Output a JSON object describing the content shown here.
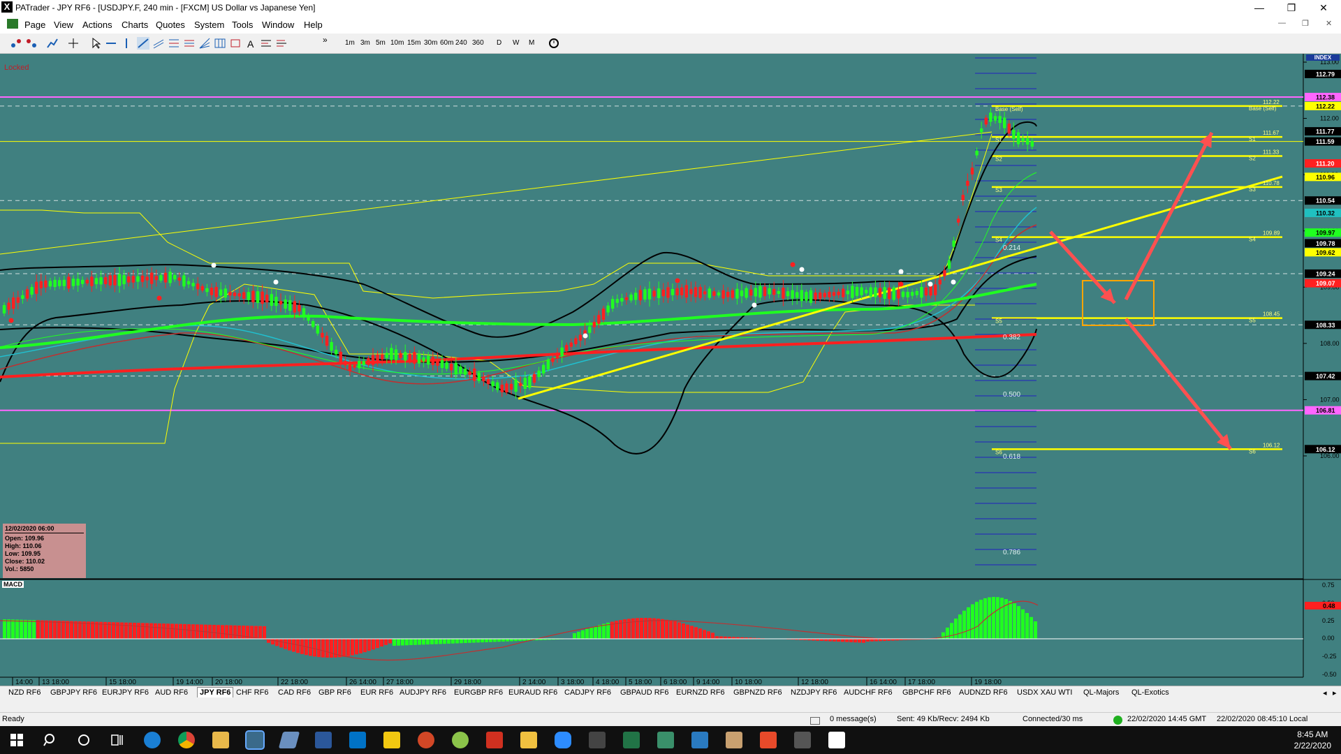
{
  "window": {
    "title": "PATrader - JPY RF6 - [USDJPY.F, 240 min - [FXCM] US Dollar vs Japanese Yen]",
    "logo": "X",
    "minimize_icon": "minimize-icon",
    "maximize_icon": "restore-icon",
    "close_icon": "close-icon"
  },
  "menu": {
    "items": [
      "Page",
      "View",
      "Actions",
      "Charts",
      "Quotes",
      "System",
      "Tools",
      "Window",
      "Help"
    ]
  },
  "toolbar": {
    "timeframes": [
      "1m",
      "3m",
      "5m",
      "10m",
      "15m",
      "30m",
      "60m",
      "240",
      "360",
      "D",
      "W",
      "M"
    ]
  },
  "chart": {
    "locked_label": "Locked",
    "index_label": "INDEX",
    "macd_label": "MACD",
    "price_axis": [
      "113.00",
      "112.00",
      "111.00",
      "110.00",
      "109.00",
      "108.00",
      "107.00",
      "106.00"
    ],
    "price_tags": [
      {
        "text": "112.79",
        "bg": "#000000",
        "fg": "#ffffff"
      },
      {
        "text": "112.38",
        "bg": "#ff66ff",
        "fg": "#000000"
      },
      {
        "text": "112.22",
        "bg": "#ffff00",
        "fg": "#000000"
      },
      {
        "text": "111.77",
        "bg": "#000000",
        "fg": "#ffffff"
      },
      {
        "text": "111.59",
        "bg": "#000000",
        "fg": "#ffffff"
      },
      {
        "text": "111.20",
        "bg": "#ff2020",
        "fg": "#ffffff"
      },
      {
        "text": "110.96",
        "bg": "#ffff00",
        "fg": "#000000"
      },
      {
        "text": "110.54",
        "bg": "#000000",
        "fg": "#ffffff"
      },
      {
        "text": "110.32",
        "bg": "#20c0c0",
        "fg": "#000000"
      },
      {
        "text": "109.97",
        "bg": "#20ff20",
        "fg": "#000000"
      },
      {
        "text": "109.78",
        "bg": "#000000",
        "fg": "#ffffff"
      },
      {
        "text": "109.62",
        "bg": "#ffff00",
        "fg": "#000000"
      },
      {
        "text": "109.24",
        "bg": "#000000",
        "fg": "#ffffff"
      },
      {
        "text": "109.07",
        "bg": "#ff2020",
        "fg": "#ffffff"
      },
      {
        "text": "108.33",
        "bg": "#000000",
        "fg": "#ffffff"
      },
      {
        "text": "107.42",
        "bg": "#000000",
        "fg": "#ffffff"
      },
      {
        "text": "106.81",
        "bg": "#ff66ff",
        "fg": "#000000"
      },
      {
        "text": "106.12",
        "bg": "#000000",
        "fg": "#ffffff"
      }
    ],
    "pivot_labels": [
      {
        "price": "112.22",
        "tag": "Base (Self)"
      },
      {
        "price": "111.67",
        "tag": "S1"
      },
      {
        "price": "111.33",
        "tag": "S2"
      },
      {
        "price": "110.78",
        "tag": "S3"
      },
      {
        "price": "109.89",
        "tag": "S4"
      },
      {
        "price": "108.45",
        "tag": "S5"
      },
      {
        "price": "106.12",
        "tag": "S6"
      }
    ],
    "fib_labels": [
      "0.214",
      "0.382",
      "0.500",
      "0.618",
      "0.786"
    ],
    "macd_axis": [
      "0.75",
      "0.50",
      "0.25",
      "0.00",
      "-0.25",
      "-0.50"
    ],
    "macd_tag": "0.48",
    "time_axis": [
      "14:00",
      "13 18:00",
      "15 18:00",
      "19 14:00",
      "20 18:00",
      "22 18:00",
      "26 14:00",
      "27 18:00",
      "29 18:00",
      "2 14:00",
      "3 18:00",
      "4 18:00",
      "5 18:00",
      "6 18:00",
      "9 14:00",
      "10 18:00",
      "12 18:00",
      "16 14:00",
      "17 18:00",
      "19 18:00"
    ]
  },
  "ohlc_box": {
    "date": "12/02/2020 06:00",
    "open": "Open: 109.96",
    "high": "High: 110.06",
    "low": "Low: 109.95",
    "close": "Close: 110.02",
    "vol": "Vol.: 5850"
  },
  "tabs": [
    "NZD RF6",
    "GBPJPY RF6",
    "EURJPY RF6",
    "AUD RF6",
    "JPY RF6",
    "CHF RF6",
    "CAD RF6",
    "GBP RF6",
    "EUR RF6",
    "AUDJPY RF6",
    "EURGBP RF6",
    "EURAUD RF6",
    "CADJPY RF6",
    "GBPAUD RF6",
    "EURNZD RF6",
    "GBPNZD RF6",
    "NZDJPY RF6",
    "AUDCHF RF6",
    "GBPCHF RF6",
    "AUDNZD RF6",
    "USDX XAU WTI",
    "QL-Majors",
    "QL-Exotics"
  ],
  "active_tab": "JPY RF6",
  "status": {
    "ready": "Ready",
    "messages": "0 message(s)",
    "traffic": "Sent: 49 Kb/Recv: 2494 Kb",
    "connection": "Connected/30 ms",
    "gmt": "22/02/2020 14:45 GMT",
    "local": "22/02/2020 08:45:10 Local"
  },
  "taskbar": {
    "time": "8:45 AM",
    "date": "2/22/2020"
  },
  "colors": {
    "chart_bg": "#408080",
    "up_candle": "#20ff20",
    "down_candle": "#ff2020",
    "trendline": "#ffff00",
    "arrow": "#ff5050",
    "box": "#ffa500"
  }
}
